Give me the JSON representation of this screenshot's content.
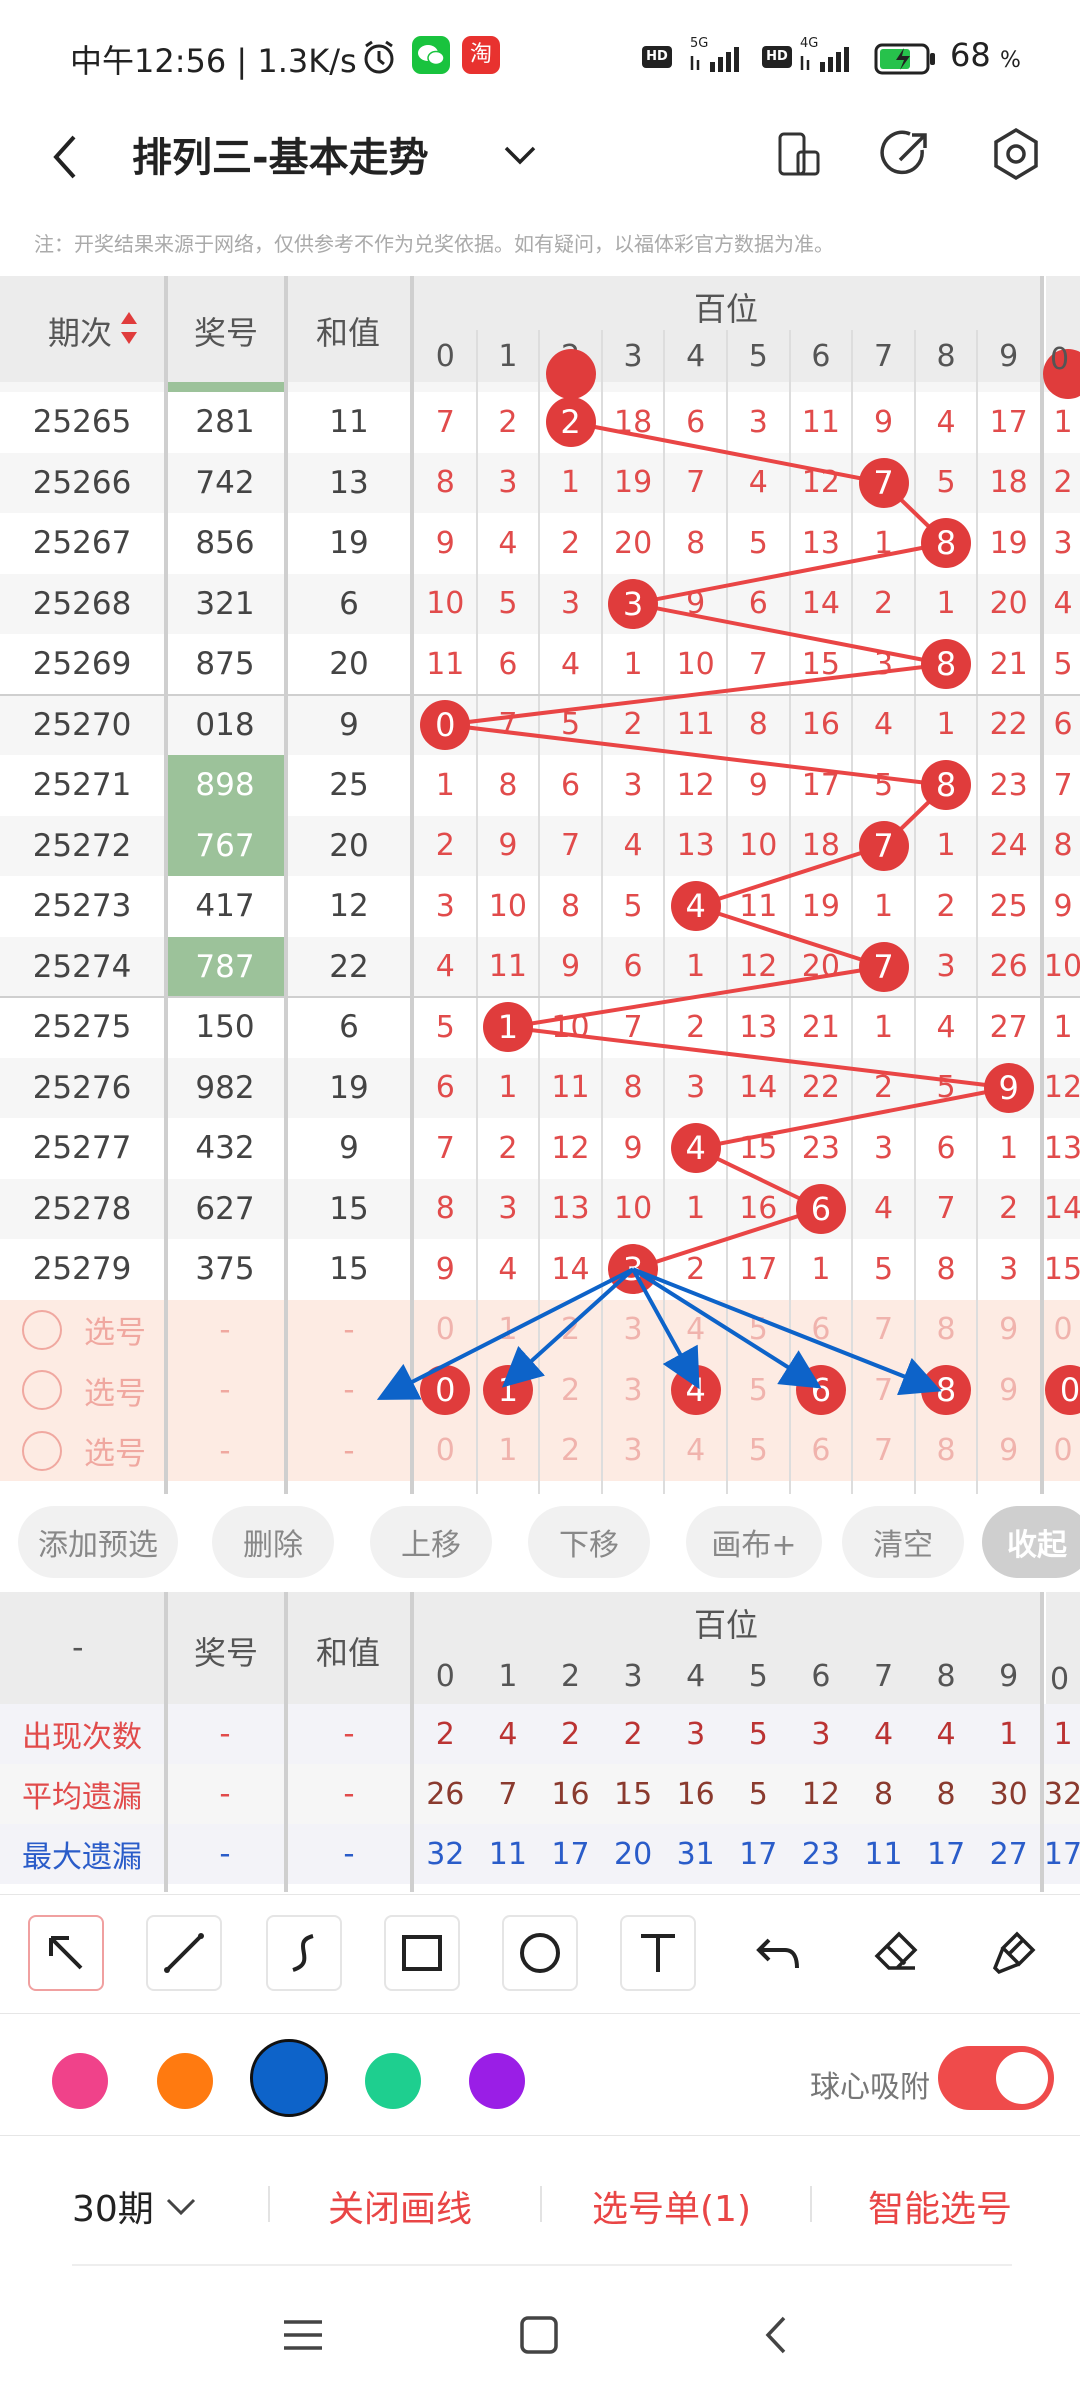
{
  "status": {
    "time": "中午12:56 | 1.3K/s",
    "battery": "68",
    "battery_unit": "%",
    "sig1": "HD",
    "net1": "5G",
    "sig2": "HD",
    "net2": "4G"
  },
  "nav": {
    "title": "排列三-基本走势"
  },
  "notice": "注：开奖结果来源于网络，仅供参考不作为兑奖依据。如有疑问，以福体彩官方数据为准。",
  "table": {
    "col_issue": "期次",
    "col_prize": "奖号",
    "col_sum": "和值",
    "group_label": "百位",
    "digits": [
      "0",
      "1",
      "2",
      "3",
      "4",
      "5",
      "6",
      "7",
      "8",
      "9"
    ],
    "extra_col_digit": "0",
    "rows": [
      {
        "issue": "25265",
        "prize": "281",
        "sum": "11",
        "hl": false,
        "cells": [
          "7",
          "2",
          "2",
          "18",
          "6",
          "3",
          "11",
          "9",
          "4",
          "17"
        ],
        "extra": "1"
      },
      {
        "issue": "25266",
        "prize": "742",
        "sum": "13",
        "hl": false,
        "cells": [
          "8",
          "3",
          "1",
          "19",
          "7",
          "4",
          "12",
          "7",
          "5",
          "18"
        ],
        "extra": "2"
      },
      {
        "issue": "25267",
        "prize": "856",
        "sum": "19",
        "hl": false,
        "cells": [
          "9",
          "4",
          "2",
          "20",
          "8",
          "5",
          "13",
          "1",
          "8",
          "19"
        ],
        "extra": "3"
      },
      {
        "issue": "25268",
        "prize": "321",
        "sum": "6",
        "hl": false,
        "cells": [
          "10",
          "5",
          "3",
          "3",
          "9",
          "6",
          "14",
          "2",
          "1",
          "20"
        ],
        "extra": "4"
      },
      {
        "issue": "25269",
        "prize": "875",
        "sum": "20",
        "hl": false,
        "cells": [
          "11",
          "6",
          "4",
          "1",
          "10",
          "7",
          "15",
          "3",
          "8",
          "21"
        ],
        "extra": "5"
      },
      {
        "issue": "25270",
        "prize": "018",
        "sum": "9",
        "hl": false,
        "cells": [
          "0",
          "7",
          "5",
          "2",
          "11",
          "8",
          "16",
          "4",
          "1",
          "22"
        ],
        "extra": "6"
      },
      {
        "issue": "25271",
        "prize": "898",
        "sum": "25",
        "hl": true,
        "cells": [
          "1",
          "8",
          "6",
          "3",
          "12",
          "9",
          "17",
          "5",
          "8",
          "23"
        ],
        "extra": "7"
      },
      {
        "issue": "25272",
        "prize": "767",
        "sum": "20",
        "hl": true,
        "cells": [
          "2",
          "9",
          "7",
          "4",
          "13",
          "10",
          "18",
          "7",
          "1",
          "24"
        ],
        "extra": "8"
      },
      {
        "issue": "25273",
        "prize": "417",
        "sum": "12",
        "hl": false,
        "cells": [
          "3",
          "10",
          "8",
          "5",
          "4",
          "11",
          "19",
          "1",
          "2",
          "25"
        ],
        "extra": "9"
      },
      {
        "issue": "25274",
        "prize": "787",
        "sum": "22",
        "hl": true,
        "cells": [
          "4",
          "11",
          "9",
          "6",
          "1",
          "12",
          "20",
          "7",
          "3",
          "26"
        ],
        "extra": "10"
      },
      {
        "issue": "25275",
        "prize": "150",
        "sum": "6",
        "hl": false,
        "cells": [
          "5",
          "1",
          "10",
          "7",
          "2",
          "13",
          "21",
          "1",
          "4",
          "27"
        ],
        "extra": "1"
      },
      {
        "issue": "25276",
        "prize": "982",
        "sum": "19",
        "hl": false,
        "cells": [
          "6",
          "1",
          "11",
          "8",
          "3",
          "14",
          "22",
          "2",
          "5",
          "9"
        ],
        "extra": "12"
      },
      {
        "issue": "25277",
        "prize": "432",
        "sum": "9",
        "hl": false,
        "cells": [
          "7",
          "2",
          "12",
          "9",
          "4",
          "15",
          "23",
          "3",
          "6",
          "1"
        ],
        "extra": "13"
      },
      {
        "issue": "25278",
        "prize": "627",
        "sum": "15",
        "hl": false,
        "cells": [
          "8",
          "3",
          "13",
          "10",
          "1",
          "16",
          "6",
          "4",
          "7",
          "2"
        ],
        "extra": "14"
      },
      {
        "issue": "25279",
        "prize": "375",
        "sum": "15",
        "hl": false,
        "cells": [
          "9",
          "4",
          "14",
          "3",
          "2",
          "17",
          "1",
          "5",
          "8",
          "3"
        ],
        "extra": "15"
      }
    ],
    "select_label": "选号",
    "dash": "-"
  },
  "actions": {
    "add": "添加预选",
    "delete": "删除",
    "up": "上移",
    "down": "下移",
    "canvas": "画布+",
    "clear": "清空",
    "collapse": "收起"
  },
  "stats": {
    "header_dash": "-",
    "rows": [
      {
        "label": "出现次数",
        "values": [
          "2",
          "4",
          "2",
          "2",
          "3",
          "5",
          "3",
          "4",
          "4",
          "1"
        ],
        "extra": "1",
        "color": "#e14b4b",
        "valcolor": "#b33"
      },
      {
        "label": "平均遗漏",
        "values": [
          "26",
          "7",
          "16",
          "15",
          "16",
          "5",
          "12",
          "8",
          "8",
          "30"
        ],
        "extra": "32",
        "color": "#e14b4b",
        "valcolor": "#8a3a2e"
      },
      {
        "label": "最大遗漏",
        "values": [
          "32",
          "11",
          "17",
          "20",
          "31",
          "17",
          "23",
          "11",
          "17",
          "27"
        ],
        "extra": "17",
        "color": "#2a5cc9",
        "valcolor": "#2a5cc9"
      }
    ]
  },
  "colors": {
    "pink": "#f0428a",
    "orange": "#ff7a10",
    "blue": "#0d63c9",
    "green": "#1ecf8f",
    "purple": "#9a1ee6",
    "accent": "#e94545"
  },
  "magnet_label": "球心吸附",
  "bottom": {
    "period": "30期",
    "close_lines": "关闭画线",
    "pick_list": "选号单(1)",
    "smart_pick": "智能选号"
  }
}
